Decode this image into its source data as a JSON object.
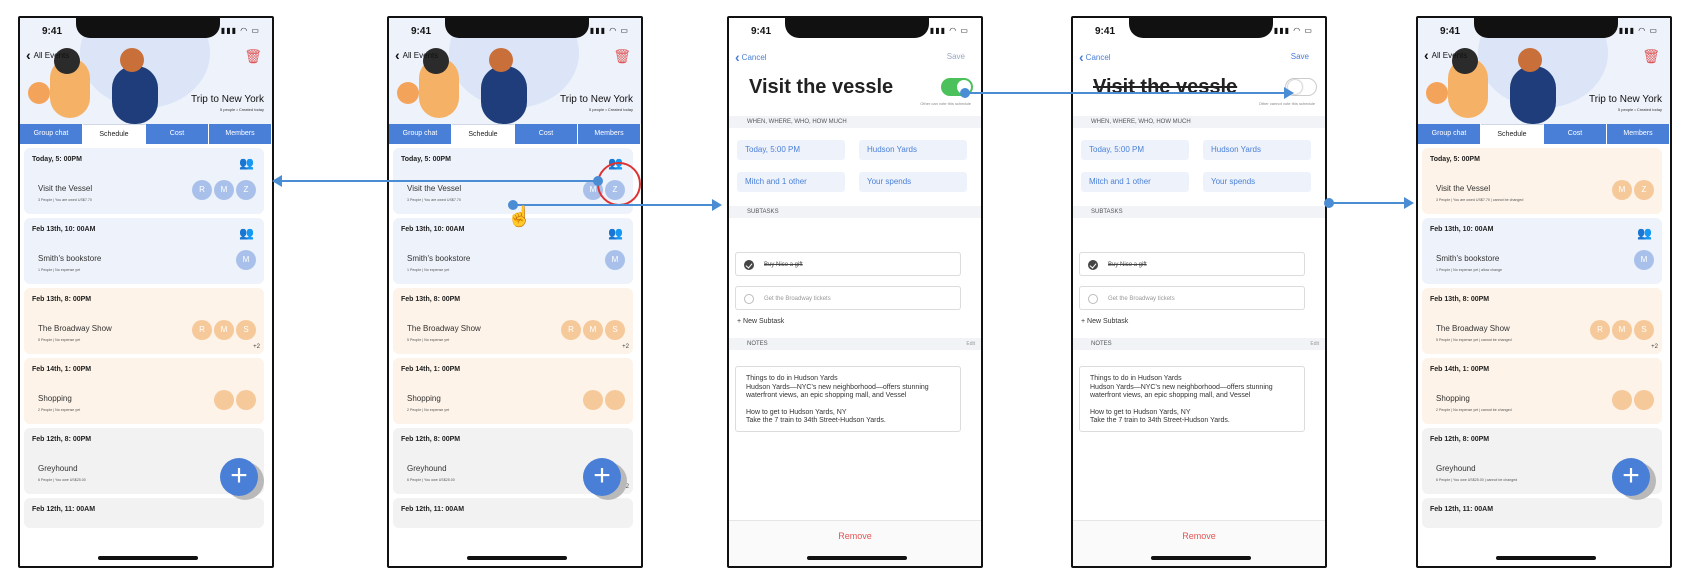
{
  "status": {
    "time": "9:41",
    "icons": "▮▮▮ ◠ ▭"
  },
  "list": {
    "back_label": "All Events",
    "trip_title": "Trip to New York",
    "trip_sub": "5 people • Created today",
    "tabs": [
      "Group chat",
      "Schedule",
      "Cost",
      "Members"
    ],
    "fab": "+",
    "events": [
      {
        "when": "Today, 5: 00PM",
        "name": "Visit the Vessel",
        "meta": "3 People | You are owed US$7.70",
        "avatars": [
          "R",
          "M",
          "Z"
        ],
        "tone": "blue"
      },
      {
        "when": "Feb 13th, 10: 00AM",
        "name": "Smith's bookstore",
        "meta": "1 People | No expense yet",
        "avatars": [
          "M"
        ],
        "tone": "blue"
      },
      {
        "when": "Feb 13th, 8: 00PM",
        "name": "The Broadway Show",
        "meta": "5 People | No expense yet",
        "avatars": [
          "R",
          "M",
          "S"
        ],
        "more": "+2",
        "tone": "orange"
      },
      {
        "when": "Feb 14th, 1: 00PM",
        "name": "Shopping",
        "meta": "2 People | No expense yet",
        "avatars": [
          "",
          ""
        ],
        "tone": "orange"
      },
      {
        "when": "Feb 12th, 8: 00PM",
        "name": "Greyhound",
        "meta": "6 People | You owe US$25.00",
        "avatars": [
          ""
        ],
        "more": "+2",
        "tone": "gray"
      },
      {
        "when": "Feb 12th, 11: 00AM",
        "tone": "gray"
      }
    ],
    "events_screen5_meta": [
      "3 People | You are owed US$7.70 | cannot be changed",
      "1 People | No expense yet | allow change",
      "5 People | No expense yet | cannot be changed",
      "2 People | No expense yet | cannot be changed",
      "6 People | You owe US$25.00 | cannot be changed"
    ],
    "screen2_avatars_row1": [
      "M",
      "Z"
    ]
  },
  "detail": {
    "cancel_label": "Cancel",
    "save_label": "Save",
    "title": "Visit the vessle",
    "vote_note_on": "Other can vote this schedule",
    "vote_note_off": "Other cannot vote this schedule",
    "section_when": "WHEN, WHERE, WHO, HOW MUCH",
    "fields": [
      "Today, 5:00 PM",
      "Hudson Yards",
      "Mitch and 1 other",
      "Your spends"
    ],
    "section_subtasks": "SUBTASKS",
    "subtasks": [
      {
        "label": "Buy Nico a gift",
        "done": true
      },
      {
        "label": "Get the Broadway tickets",
        "done": false
      }
    ],
    "new_subtask": "+  New Subtask",
    "section_notes": "NOTES",
    "edit_label": "Edit",
    "notes": [
      "Things to do in Hudson Yards",
      "Hudson Yards—NYC's new neighborhood—offers stunning",
      "waterfront views, an epic shopping mall, and Vessel",
      "",
      "How to get to Hudson Yards, NY",
      "Take the 7 train to 34th Street-Hudson Yards."
    ],
    "remove_label": "Remove"
  },
  "colors": {
    "accent": "#4a7fd8",
    "toggle_on": "#4cc05a",
    "danger": "#e05555",
    "annotation": "#4a8dd4"
  }
}
